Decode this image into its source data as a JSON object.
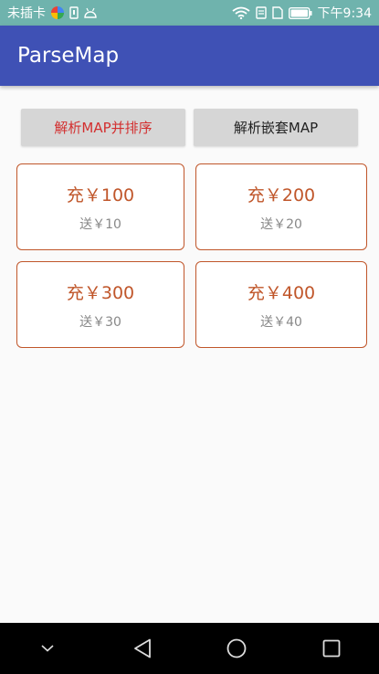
{
  "status_bar": {
    "carrier": "未插卡",
    "time": "下午9:34",
    "icons": [
      "app-colorful-icon",
      "sim-icon",
      "android-icon",
      "wifi-icon",
      "notification-icon",
      "sim-card-icon",
      "battery-icon"
    ]
  },
  "app_bar": {
    "title": "ParseMap"
  },
  "buttons": {
    "sort_label": "解析MAP并排序",
    "nested_label": "解析嵌套MAP"
  },
  "cards": [
    {
      "amount": "充￥100",
      "bonus": "送￥10"
    },
    {
      "amount": "充￥200",
      "bonus": "送￥20"
    },
    {
      "amount": "充￥300",
      "bonus": "送￥30"
    },
    {
      "amount": "充￥400",
      "bonus": "送￥40"
    }
  ],
  "nav_bar": {
    "icons": [
      "chevron-down-icon",
      "back-icon",
      "home-icon",
      "recents-icon"
    ]
  },
  "colors": {
    "status_bar": "#6fb3ad",
    "app_bar": "#3f51b5",
    "accent_orange": "#c0562a",
    "red_label": "#d32f2f"
  }
}
